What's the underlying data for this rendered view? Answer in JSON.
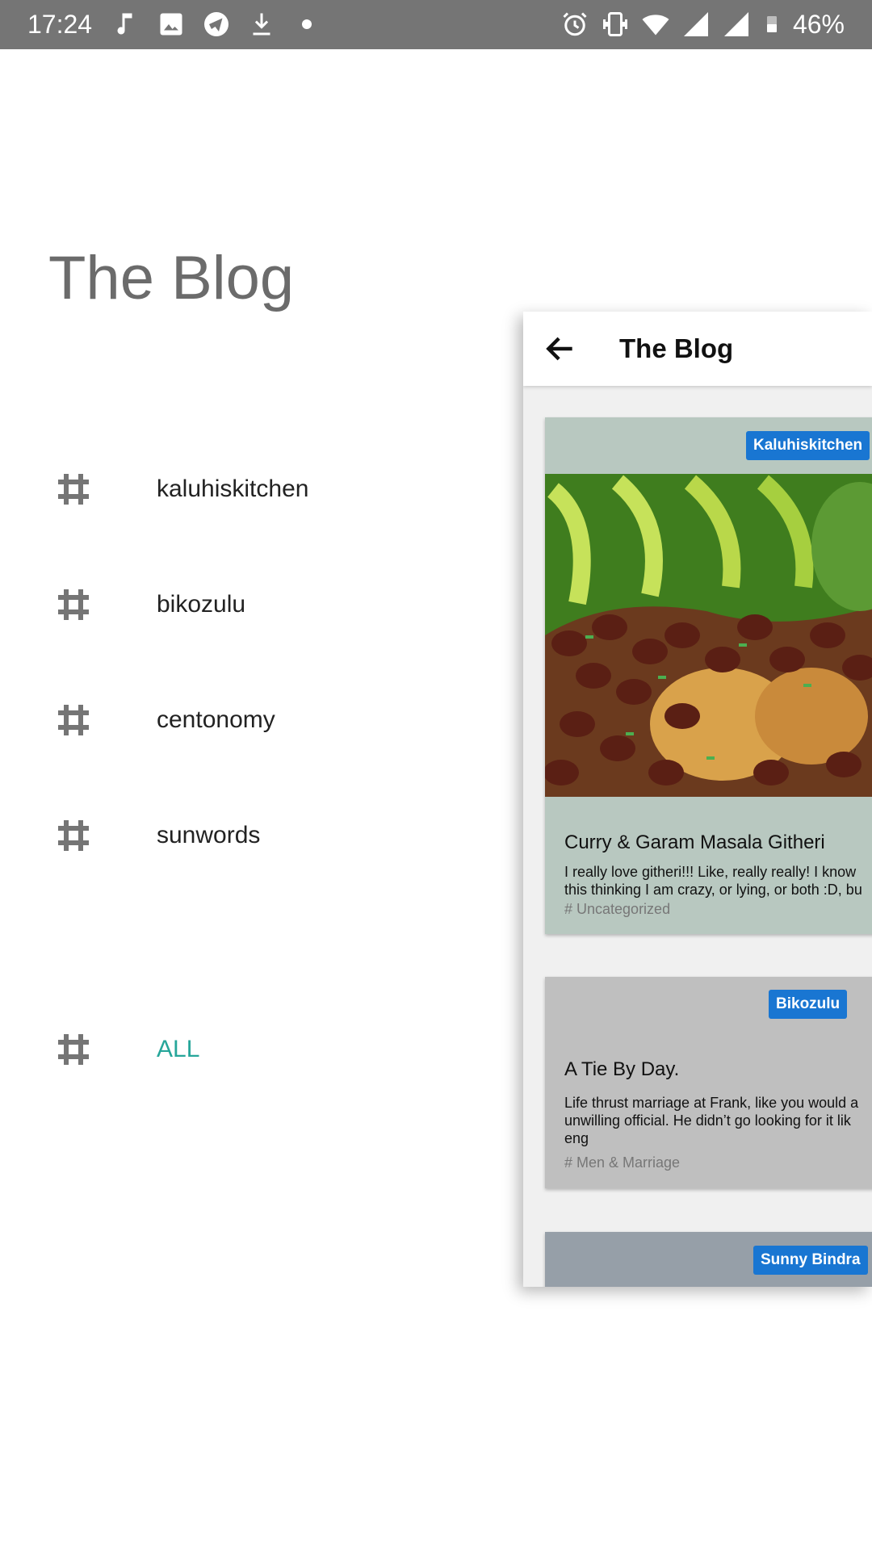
{
  "status_bar": {
    "time": "17:24",
    "battery": "46%",
    "left_icons": [
      "music-note-icon",
      "image-icon",
      "telegram-icon",
      "download-icon",
      "dot-icon"
    ],
    "right_icons": [
      "alarm-icon",
      "vibrate-icon",
      "wifi-icon",
      "signal-icon",
      "signal-icon",
      "battery-icon"
    ]
  },
  "drawer": {
    "title": "The Blog",
    "items": [
      {
        "label": "kaluhiskitchen",
        "icon": "hash-icon"
      },
      {
        "label": "bikozulu",
        "icon": "hash-icon"
      },
      {
        "label": "centonomy",
        "icon": "hash-icon"
      },
      {
        "label": "sunwords",
        "icon": "hash-icon"
      }
    ],
    "all_item": {
      "label": "ALL",
      "icon": "hash-icon",
      "color": "#26a69a"
    }
  },
  "panel": {
    "title": "The Blog",
    "back_icon": "arrow-back-icon",
    "cards": [
      {
        "badge": "Kaluhiskitchen",
        "title": "Curry & Garam Masala Githeri",
        "excerpt": "I really love githeri!!! Like, really really! I know\nthis thinking I am crazy, or lying, or both :D, bu",
        "category": "# Uncategorized",
        "bg": "#b8c8c0"
      },
      {
        "badge": "Bikozulu",
        "title": "A Tie By Day.",
        "excerpt": "Life thrust marriage at Frank, like you would a\nunwilling official. He didn’t go looking for it lik\neng",
        "category": "# Men & Marriage",
        "bg": "#bfbfbf"
      },
      {
        "badge": "Sunny Bindra",
        "bg": "#969fa8"
      }
    ],
    "badge_color": "#1976d2"
  }
}
